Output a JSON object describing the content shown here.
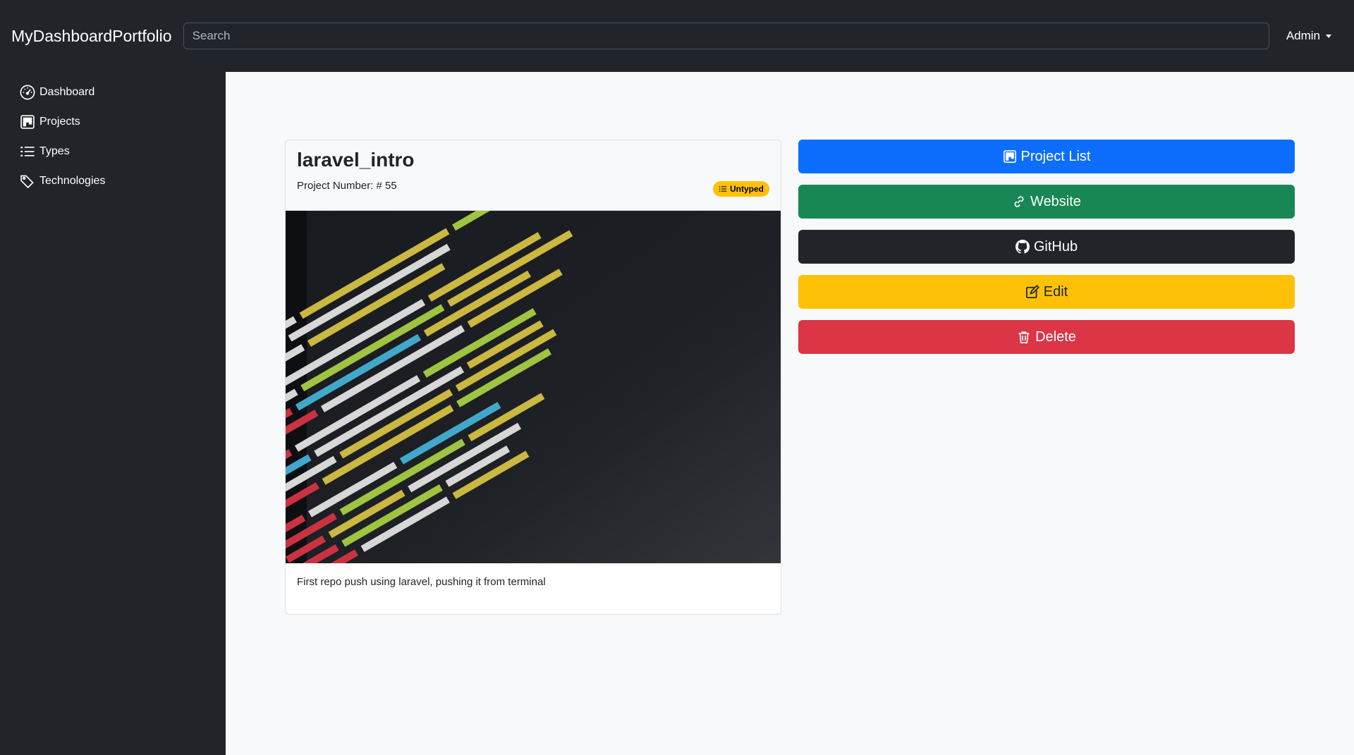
{
  "navbar": {
    "brand": "MyDashboardPortfolio",
    "search_placeholder": "Search",
    "user_label": "Admin"
  },
  "sidebar": {
    "items": [
      {
        "label": "Dashboard",
        "icon": "speedometer-icon"
      },
      {
        "label": "Projects",
        "icon": "kanban-icon"
      },
      {
        "label": "Types",
        "icon": "list-icon"
      },
      {
        "label": "Technologies",
        "icon": "tags-icon"
      }
    ]
  },
  "project": {
    "title": "laravel_intro",
    "number_label": "Project Number: # 55",
    "type_badge": "Untyped",
    "image_alt": "code screenshot",
    "description": "First repo push using laravel, pushing it from terminal"
  },
  "actions": {
    "project_list": "Project List",
    "website": "Website",
    "github": "GitHub",
    "edit": "Edit",
    "delete": "Delete"
  },
  "colors": {
    "primary": "#0d6efd",
    "success": "#198754",
    "dark": "#212529",
    "warning": "#ffc107",
    "danger": "#dc3545"
  }
}
